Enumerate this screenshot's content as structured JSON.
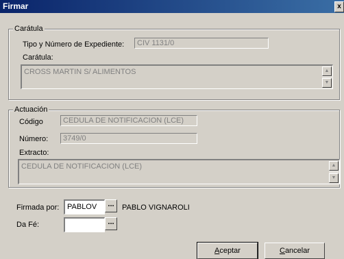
{
  "window": {
    "title": "Firmar",
    "close_glyph": "x"
  },
  "caratula_group": {
    "legend": "Carátula",
    "tipo_label": "Tipo y Número de Expediente:",
    "tipo_value": "CIV 1131/0",
    "caratula_label": "Carátula:",
    "caratula_value": "CROSS MARTIN S/ ALIMENTOS"
  },
  "actuacion_group": {
    "legend": "Actuación",
    "codigo_label": "Código",
    "codigo_value": "CEDULA DE NOTIFICACION (LCE)",
    "numero_label": "Número:",
    "numero_value": "3749/0",
    "extracto_label": "Extracto:",
    "extracto_value": "CEDULA DE NOTIFICACION (LCE)"
  },
  "firmada_por": {
    "label": "Firmada por:",
    "value": "PABLOV",
    "browse": "...",
    "full_name": "PABLO VIGNAROLI"
  },
  "da_fe": {
    "label": "Da Fé:",
    "value": "",
    "browse": "..."
  },
  "buttons": {
    "aceptar_first": "A",
    "aceptar_rest": "ceptar",
    "cancelar_first": "C",
    "cancelar_rest": "ancelar"
  }
}
